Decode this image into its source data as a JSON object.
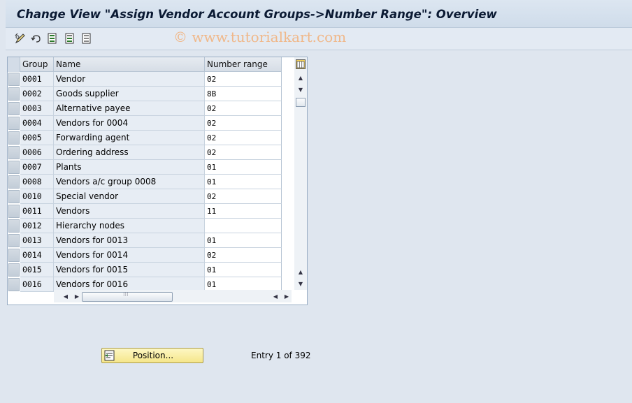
{
  "title": "Change View \"Assign Vendor Account Groups->Number Range\": Overview",
  "watermark": "© www.tutorialkart.com",
  "toolbar": {
    "icons": [
      "display-change-icon",
      "undo-icon",
      "select-all-icon",
      "select-block-icon",
      "deselect-all-icon"
    ]
  },
  "table": {
    "columns": [
      "Group",
      "Name",
      "Number range"
    ],
    "rows": [
      {
        "group": "0001",
        "name": "Vendor",
        "range": "02"
      },
      {
        "group": "0002",
        "name": "Goods supplier",
        "range": "8B"
      },
      {
        "group": "0003",
        "name": "Alternative payee",
        "range": "02"
      },
      {
        "group": "0004",
        "name": "Vendors for 0004",
        "range": "02"
      },
      {
        "group": "0005",
        "name": "Forwarding agent",
        "range": "02"
      },
      {
        "group": "0006",
        "name": "Ordering address",
        "range": "02"
      },
      {
        "group": "0007",
        "name": "Plants",
        "range": "01"
      },
      {
        "group": "0008",
        "name": "Vendors  a/c group 0008",
        "range": "01"
      },
      {
        "group": "0010",
        "name": "Special vendor",
        "range": "02"
      },
      {
        "group": "0011",
        "name": "Vendors",
        "range": "11"
      },
      {
        "group": "0012",
        "name": "Hierarchy nodes",
        "range": ""
      },
      {
        "group": "0013",
        "name": "Vendors for 0013",
        "range": "01"
      },
      {
        "group": "0014",
        "name": "Vendors for 0014",
        "range": "02"
      },
      {
        "group": "0015",
        "name": "Vendors for 0015",
        "range": "01"
      },
      {
        "group": "0016",
        "name": "Vendors for 0016",
        "range": "01"
      }
    ]
  },
  "position_button": {
    "label": "Position..."
  },
  "entry_text": "Entry 1 of 392",
  "colors": {
    "accent": "#f5e68a",
    "title": "#0b1a33",
    "background": "#dfe6ef"
  }
}
